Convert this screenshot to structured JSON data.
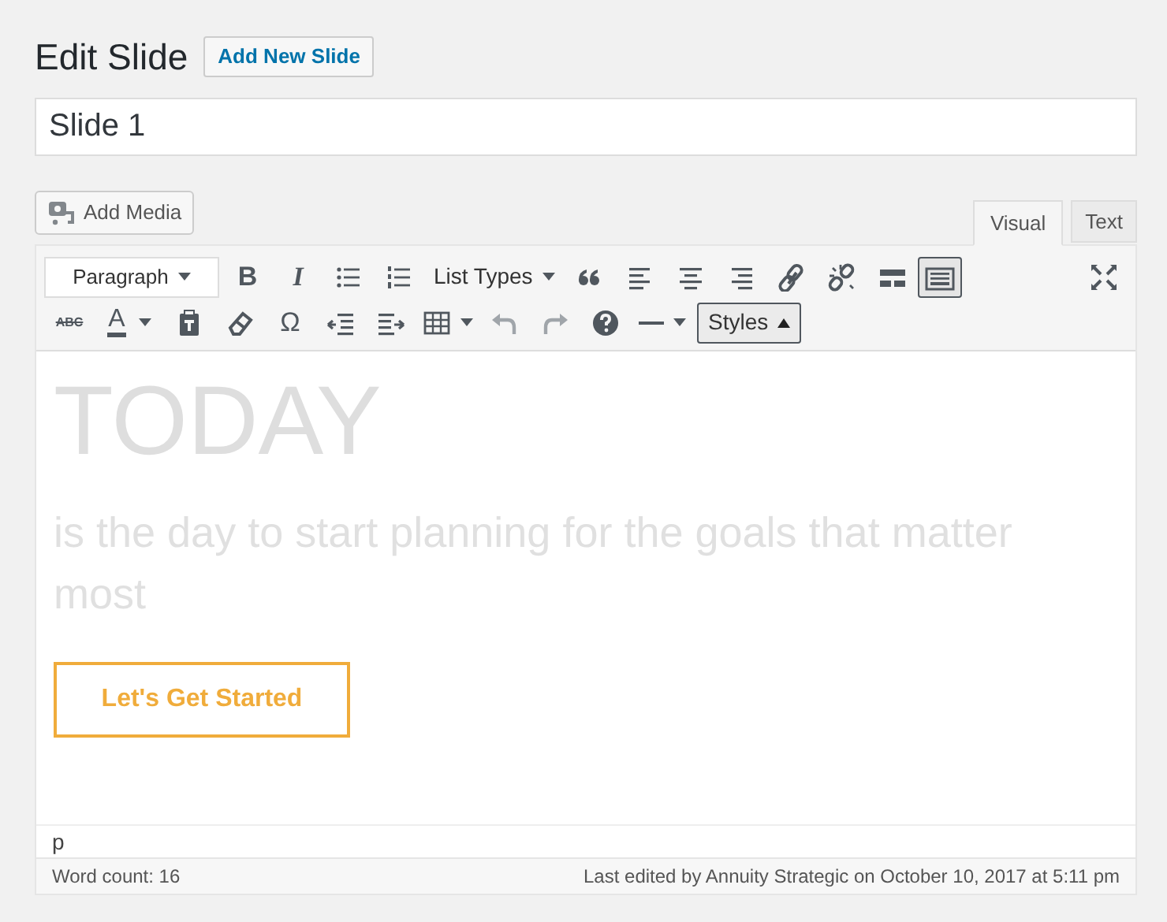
{
  "page_title": "Edit Slide",
  "add_new_button": "Add New Slide",
  "slide_title": {
    "value": "Slide 1"
  },
  "add_media_button": "Add Media",
  "tabs": [
    {
      "label": "Visual",
      "selected": true
    },
    {
      "label": "Text",
      "selected": false
    }
  ],
  "toolbar": {
    "format_select": "Paragraph",
    "bold": "B",
    "italic": "I",
    "list_types": "List Types",
    "toolbar_toggle_pressed": true,
    "strikethrough": "ABC",
    "text_color": "A",
    "special_character": "Ω",
    "undo_disabled": true,
    "redo_disabled": true,
    "styles_menu": "Styles"
  },
  "content": {
    "heading": "TODAY",
    "paragraph": "is the day to start planning for the goals that matter most",
    "cta_button": "Let's Get Started"
  },
  "element_path": "p",
  "status_bar": {
    "word_count": "Word count: 16",
    "last_edited": "Last edited by Annuity Strategic on October 10, 2017 at 5:11 pm"
  }
}
